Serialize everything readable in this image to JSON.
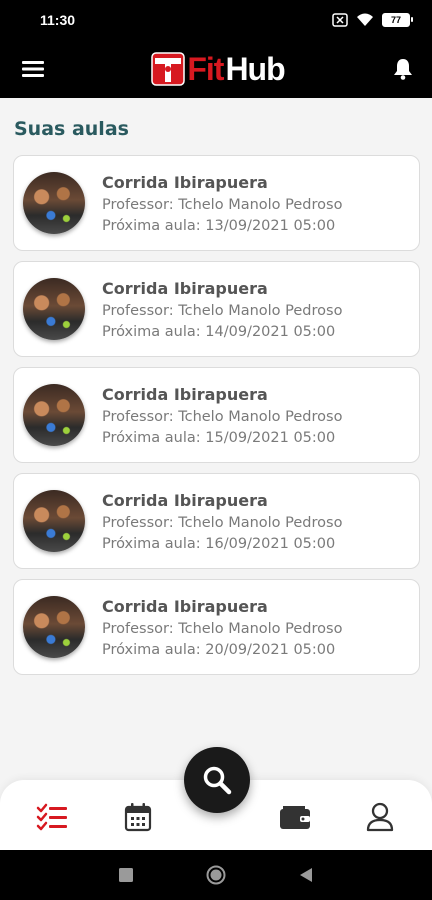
{
  "status_bar": {
    "time": "11:30",
    "battery": "77",
    "icons": [
      "sim-off-icon",
      "wifi-icon",
      "battery-icon"
    ]
  },
  "app_bar": {
    "logo_fit": "Fit",
    "logo_hub": "Hub",
    "menu_icon": "menu-icon",
    "bell_icon": "bell-icon",
    "brand_color": "#d71920"
  },
  "main": {
    "section_title": "Suas aulas",
    "classes": [
      {
        "title": "Corrida Ibirapuera",
        "teacher": "Professor: Tchelo Manolo Pedroso",
        "next": "Próxima aula: 13/09/2021 05:00"
      },
      {
        "title": "Corrida Ibirapuera",
        "teacher": "Professor: Tchelo Manolo Pedroso",
        "next": "Próxima aula: 14/09/2021 05:00"
      },
      {
        "title": "Corrida Ibirapuera",
        "teacher": "Professor: Tchelo Manolo Pedroso",
        "next": "Próxima aula: 15/09/2021 05:00"
      },
      {
        "title": "Corrida Ibirapuera",
        "teacher": "Professor: Tchelo Manolo Pedroso",
        "next": "Próxima aula: 16/09/2021 05:00"
      },
      {
        "title": "Corrida Ibirapuera",
        "teacher": "Professor: Tchelo Manolo Pedroso",
        "next": "Próxima aula: 20/09/2021 05:00"
      }
    ]
  },
  "bottom_nav": {
    "items": [
      "checklist-icon",
      "calendar-icon",
      "wallet-icon",
      "user-icon"
    ],
    "active_color": "#d71920",
    "fab_icon": "search-icon"
  },
  "system_nav": {
    "items": [
      "recents-icon",
      "home-icon",
      "back-icon"
    ]
  }
}
